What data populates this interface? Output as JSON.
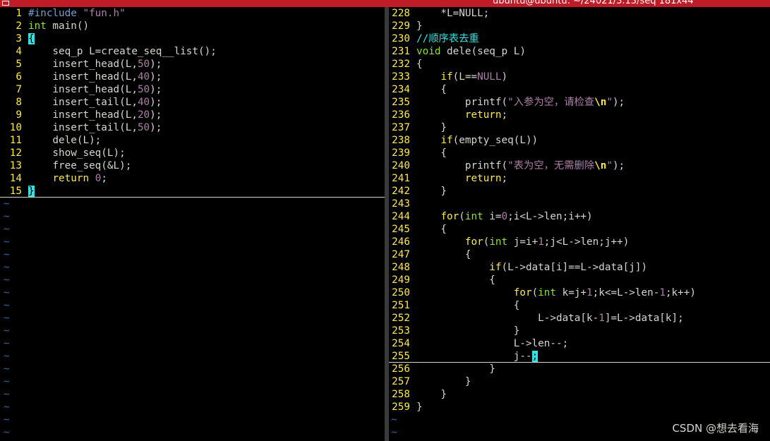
{
  "window": {
    "title": "ubuntu@ubuntu: ~/24021/3.13/seq 181x44"
  },
  "left_pane": {
    "lines": [
      {
        "n": "1",
        "parts": [
          {
            "t": "#include ",
            "c": "pp"
          },
          {
            "t": "\"fun.h\"",
            "c": "st"
          }
        ]
      },
      {
        "n": "2",
        "parts": [
          {
            "t": "int",
            "c": "ty"
          },
          {
            "t": " main()"
          }
        ]
      },
      {
        "n": "3",
        "parts": [
          {
            "t": "{",
            "c": "bm"
          }
        ]
      },
      {
        "n": "4",
        "parts": [
          {
            "t": "    seq_p L=create_seq__list();"
          }
        ]
      },
      {
        "n": "5",
        "parts": [
          {
            "t": "    insert_head(L,"
          },
          {
            "t": "50",
            "c": "nu"
          },
          {
            "t": ");"
          }
        ]
      },
      {
        "n": "6",
        "parts": [
          {
            "t": "    insert_head(L,"
          },
          {
            "t": "40",
            "c": "nu"
          },
          {
            "t": ");"
          }
        ]
      },
      {
        "n": "7",
        "parts": [
          {
            "t": "    insert_head(L,"
          },
          {
            "t": "50",
            "c": "nu"
          },
          {
            "t": ");"
          }
        ]
      },
      {
        "n": "8",
        "parts": [
          {
            "t": "    insert_tail(L,"
          },
          {
            "t": "40",
            "c": "nu"
          },
          {
            "t": ");"
          }
        ]
      },
      {
        "n": "9",
        "parts": [
          {
            "t": "    insert_head(L,"
          },
          {
            "t": "20",
            "c": "nu"
          },
          {
            "t": ");"
          }
        ]
      },
      {
        "n": "10",
        "parts": [
          {
            "t": "    insert_tail(L,"
          },
          {
            "t": "50",
            "c": "nu"
          },
          {
            "t": ");"
          }
        ]
      },
      {
        "n": "11",
        "parts": [
          {
            "t": "    dele(L);"
          }
        ]
      },
      {
        "n": "12",
        "parts": [
          {
            "t": "    show_seq(L);"
          }
        ]
      },
      {
        "n": "13",
        "parts": [
          {
            "t": "    free_seq(&L);"
          }
        ]
      },
      {
        "n": "14",
        "parts": [
          {
            "t": "    "
          },
          {
            "t": "return",
            "c": "kw"
          },
          {
            "t": " "
          },
          {
            "t": "0",
            "c": "nu"
          },
          {
            "t": ";"
          }
        ]
      },
      {
        "n": "15",
        "parts": [
          {
            "t": "}",
            "c": "bm"
          }
        ]
      }
    ],
    "tilde": "~",
    "tilde_count": 19
  },
  "right_pane": {
    "lines": [
      {
        "n": "228",
        "parts": [
          {
            "t": "    *L=NULL;"
          }
        ]
      },
      {
        "n": "229",
        "parts": [
          {
            "t": "}"
          }
        ]
      },
      {
        "n": "230",
        "parts": [
          {
            "t": "//顺序表去重",
            "c": "cm"
          }
        ]
      },
      {
        "n": "231",
        "parts": [
          {
            "t": "void",
            "c": "ty"
          },
          {
            "t": " dele(seq_p L)"
          }
        ]
      },
      {
        "n": "232",
        "parts": [
          {
            "t": "{"
          }
        ]
      },
      {
        "n": "233",
        "parts": [
          {
            "t": "    "
          },
          {
            "t": "if",
            "c": "kw"
          },
          {
            "t": "(L=="
          },
          {
            "t": "NULL",
            "c": "nu"
          },
          {
            "t": ")"
          }
        ]
      },
      {
        "n": "234",
        "parts": [
          {
            "t": "    {"
          }
        ]
      },
      {
        "n": "235",
        "parts": [
          {
            "t": "        printf("
          },
          {
            "t": "\"入参为空，请检查",
            "c": "st"
          },
          {
            "t": "\\n",
            "c": "sc"
          },
          {
            "t": "\"",
            "c": "st"
          },
          {
            "t": ");"
          }
        ]
      },
      {
        "n": "236",
        "parts": [
          {
            "t": "        "
          },
          {
            "t": "return",
            "c": "kw"
          },
          {
            "t": ";"
          }
        ]
      },
      {
        "n": "237",
        "parts": [
          {
            "t": "    }"
          }
        ]
      },
      {
        "n": "238",
        "parts": [
          {
            "t": "    "
          },
          {
            "t": "if",
            "c": "kw"
          },
          {
            "t": "(empty_seq(L))"
          }
        ]
      },
      {
        "n": "239",
        "parts": [
          {
            "t": "    {"
          }
        ]
      },
      {
        "n": "240",
        "parts": [
          {
            "t": "        printf("
          },
          {
            "t": "\"表为空，无需删除",
            "c": "st"
          },
          {
            "t": "\\n",
            "c": "sc"
          },
          {
            "t": "\"",
            "c": "st"
          },
          {
            "t": ");"
          }
        ]
      },
      {
        "n": "241",
        "parts": [
          {
            "t": "        "
          },
          {
            "t": "return",
            "c": "kw"
          },
          {
            "t": ";"
          }
        ]
      },
      {
        "n": "242",
        "parts": [
          {
            "t": "    }"
          }
        ]
      },
      {
        "n": "243",
        "parts": []
      },
      {
        "n": "244",
        "parts": [
          {
            "t": "    "
          },
          {
            "t": "for",
            "c": "kw"
          },
          {
            "t": "("
          },
          {
            "t": "int",
            "c": "ty"
          },
          {
            "t": " i="
          },
          {
            "t": "0",
            "c": "nu"
          },
          {
            "t": ";i<L->len;i++)"
          }
        ]
      },
      {
        "n": "245",
        "parts": [
          {
            "t": "    {"
          }
        ]
      },
      {
        "n": "246",
        "parts": [
          {
            "t": "        "
          },
          {
            "t": "for",
            "c": "kw"
          },
          {
            "t": "("
          },
          {
            "t": "int",
            "c": "ty"
          },
          {
            "t": " j=i+"
          },
          {
            "t": "1",
            "c": "nu"
          },
          {
            "t": ";j<L->len;j++)"
          }
        ]
      },
      {
        "n": "247",
        "parts": [
          {
            "t": "        {"
          }
        ]
      },
      {
        "n": "248",
        "parts": [
          {
            "t": "            "
          },
          {
            "t": "if",
            "c": "kw"
          },
          {
            "t": "(L->data[i]==L->data[j])"
          }
        ]
      },
      {
        "n": "249",
        "parts": [
          {
            "t": "            {"
          }
        ]
      },
      {
        "n": "250",
        "parts": [
          {
            "t": "                "
          },
          {
            "t": "for",
            "c": "kw"
          },
          {
            "t": "("
          },
          {
            "t": "int",
            "c": "ty"
          },
          {
            "t": " k=j+"
          },
          {
            "t": "1",
            "c": "nu"
          },
          {
            "t": ";k<=L->len-"
          },
          {
            "t": "1",
            "c": "nu"
          },
          {
            "t": ";k++)"
          }
        ]
      },
      {
        "n": "251",
        "parts": [
          {
            "t": "                {"
          }
        ]
      },
      {
        "n": "252",
        "parts": [
          {
            "t": "                    L->data[k-"
          },
          {
            "t": "1",
            "c": "nu"
          },
          {
            "t": "]=L->data[k];"
          }
        ]
      },
      {
        "n": "253",
        "parts": [
          {
            "t": "                }"
          }
        ]
      },
      {
        "n": "254",
        "parts": [
          {
            "t": "                L->len--;"
          }
        ]
      },
      {
        "n": "255",
        "parts": [
          {
            "t": "                j--"
          },
          {
            "t": ";",
            "c": "cursor"
          }
        ]
      },
      {
        "n": "256",
        "parts": [
          {
            "t": "            }"
          }
        ]
      },
      {
        "n": "257",
        "parts": [
          {
            "t": "        }"
          }
        ]
      },
      {
        "n": "258",
        "parts": [
          {
            "t": "    }"
          }
        ]
      },
      {
        "n": "259",
        "parts": [
          {
            "t": "}"
          }
        ]
      }
    ],
    "tilde": "~",
    "tilde_count": 2
  },
  "watermark": "CSDN @想去看海",
  "colors": {
    "titlebar": "#c01c28",
    "line_number": "#fce94f",
    "keyword": "#fce94f",
    "type": "#8ae234",
    "string": "#ad7fa8",
    "comment": "#34e2e2",
    "cursor": "#34e2e2",
    "tilde": "#3465a4"
  }
}
